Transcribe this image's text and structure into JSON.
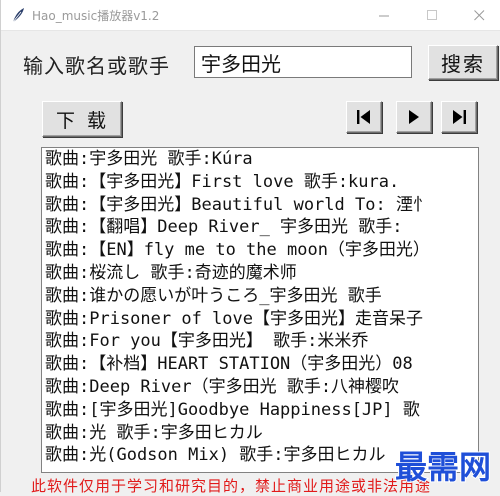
{
  "window": {
    "title": "Hao_music播放器v1.2",
    "min_icon": "minimize-icon",
    "max_icon": "maximize-icon",
    "close_icon": "close-icon"
  },
  "search": {
    "label": "输入歌名或歌手",
    "value": "宇多田光",
    "button_label": "搜索"
  },
  "controls": {
    "download_label": "下载",
    "prev_icon": "skip-back-icon",
    "play_icon": "play-icon",
    "next_icon": "skip-forward-icon"
  },
  "results": [
    "歌曲:宇多田光  歌手:Kúra",
    "歌曲:【宇多田光】First love  歌手:kura.",
    "歌曲:【宇多田光】Beautiful world To: 湮忄",
    "歌曲:【翻唱】Deep River_ 宇多田光  歌手:",
    "歌曲:【EN】fly me to the moon（宇多田光）",
    "歌曲:桜流し  歌手:奇迹的魔术师",
    "歌曲:谁かの愿いが叶うころ_宇多田光  歌手",
    "歌曲:Prisoner of love【宇多田光】走音呆子",
    "歌曲:For you【宇多田光】  歌手:米米乔",
    "歌曲:【补档】HEART STATION（宇多田光）08",
    "歌曲:Deep River（宇多田光  歌手:八神樱吹",
    "歌曲:[宇多田光]Goodbye Happiness[JP]  歌",
    "歌曲:光  歌手:宇多田ヒカル",
    "歌曲:光(Godson Mix)  歌手:宇多田ヒカル"
  ],
  "notice": "此软件仅用于学习和研究目的，禁止商业用途或非法用途",
  "watermark": {
    "text": "最需网",
    "color": "#1f4fd8"
  }
}
